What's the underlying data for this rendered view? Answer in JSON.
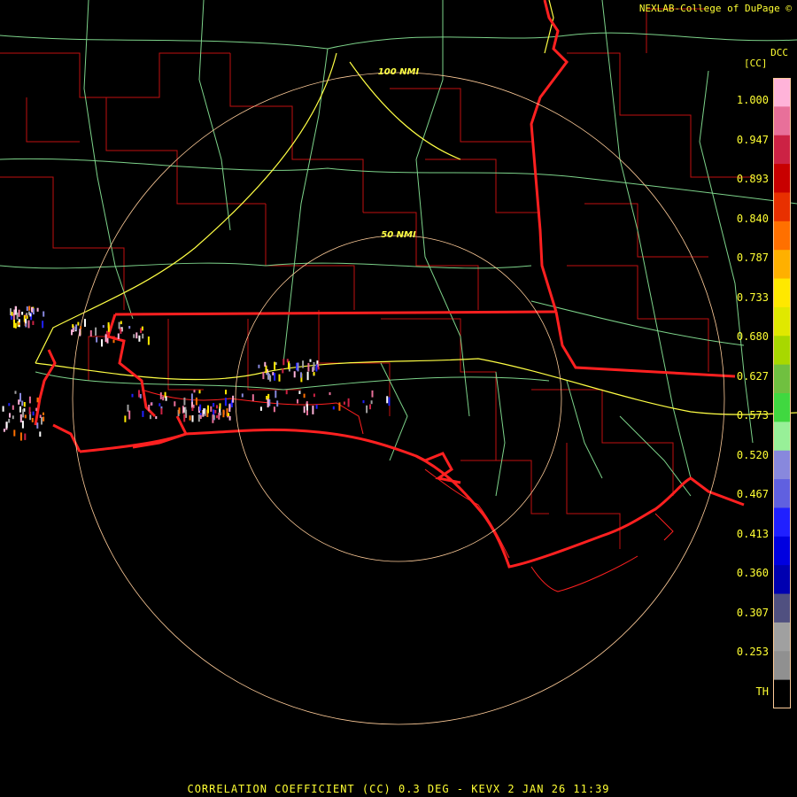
{
  "header": {
    "credit": "NEXLAB-College of DuPage ©",
    "site": "DCC",
    "unit": "[CC]"
  },
  "range_rings": [
    "100 NMI",
    "50 NMI"
  ],
  "legend": {
    "ticks": [
      "1.000",
      "0.947",
      "0.893",
      "0.840",
      "0.787",
      "0.733",
      "0.680",
      "0.627",
      "0.573",
      "0.520",
      "0.467",
      "0.413",
      "0.360",
      "0.307",
      "0.253",
      "TH"
    ],
    "colors": [
      "#ffb3d9",
      "#e8709a",
      "#cc2244",
      "#c80000",
      "#e83000",
      "#ff7000",
      "#ffb000",
      "#ffe800",
      "#e0e800",
      "#a8d800",
      "#70c040",
      "#40d840",
      "#98f098",
      "#8888dd",
      "#6060e0",
      "#2020ff",
      "#0000e0",
      "#0000b0",
      "#505080",
      "#a0a0a0",
      "#909090",
      "#000000"
    ]
  },
  "colors": {
    "state_border": "#ff2020",
    "county_lines": "#c01010",
    "highways": "#7dd38a",
    "interstates": "#ffff44",
    "rings": "#ffcc99",
    "text": "#ffff33"
  },
  "footer": "CORRELATION COEFFICIENT (CC) 0.3 DEG - KEVX 2 JAN 26 11:39"
}
